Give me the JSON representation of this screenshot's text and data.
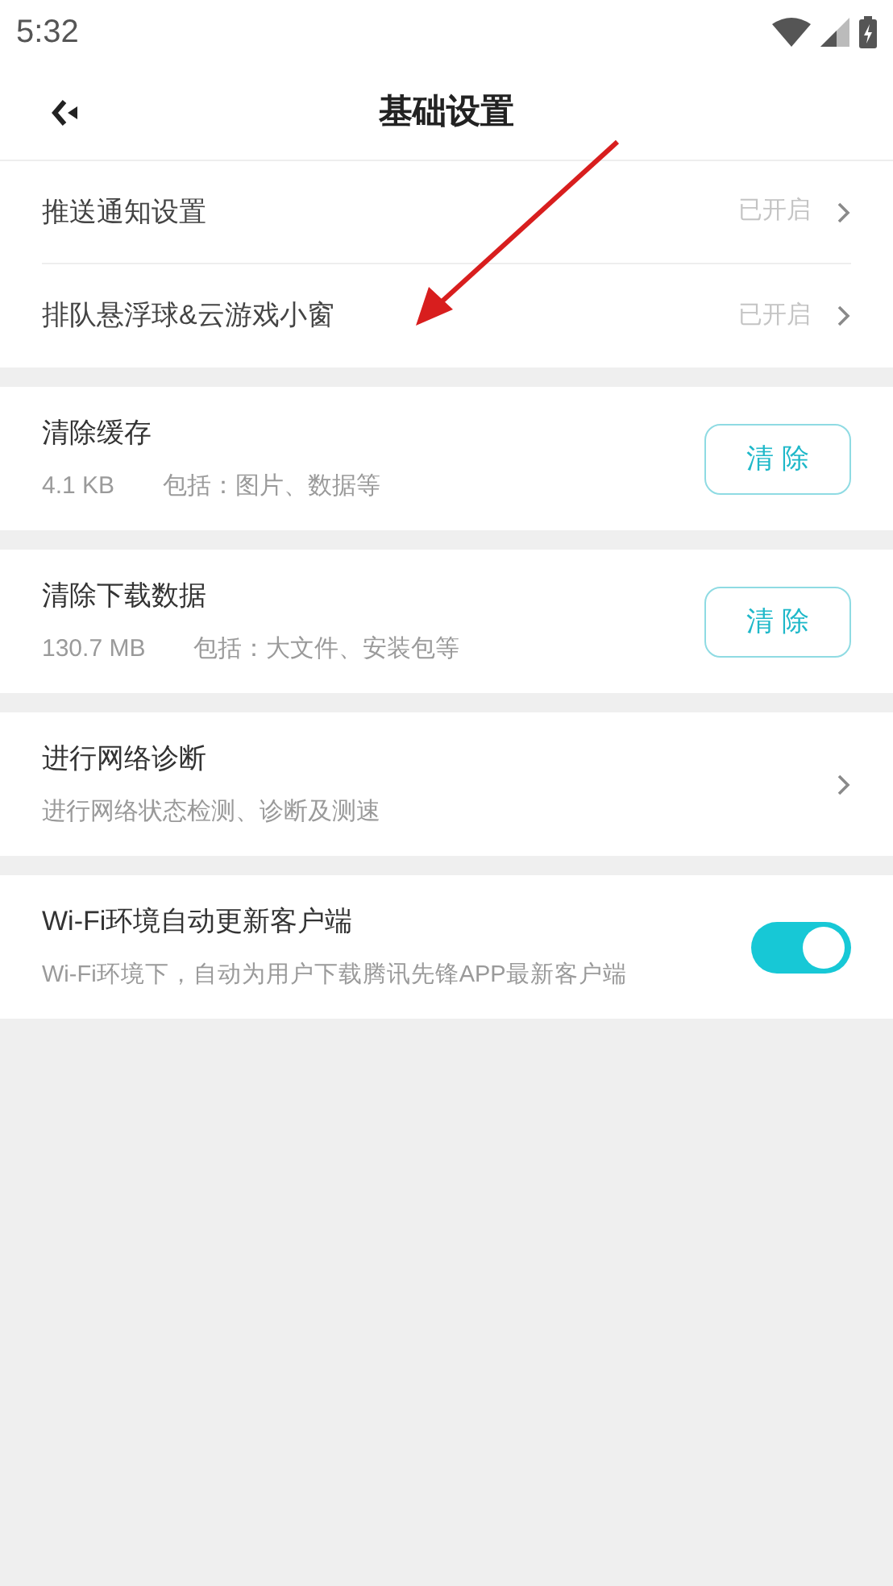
{
  "status_bar": {
    "time": "5:32"
  },
  "header": {
    "title": "基础设置"
  },
  "notification_group": [
    {
      "label": "推送通知设置",
      "status": "已开启"
    },
    {
      "label": "排队悬浮球&云游戏小窗",
      "status": "已开启"
    }
  ],
  "sections": [
    {
      "kind": "clear",
      "title": "清除缓存",
      "size": "4.1 KB",
      "description": "包括：图片、数据等",
      "button": "清 除"
    },
    {
      "kind": "clear",
      "title": "清除下载数据",
      "size": "130.7 MB",
      "description": "包括：大文件、安装包等",
      "button": "清 除"
    },
    {
      "kind": "nav",
      "title": "进行网络诊断",
      "description": "进行网络状态检测、诊断及测速"
    },
    {
      "kind": "toggle",
      "title": "Wi-Fi环境自动更新客户端",
      "description": "Wi-Fi环境下，自动为用户下载腾讯先锋APP最新客户端",
      "on": true
    }
  ]
}
